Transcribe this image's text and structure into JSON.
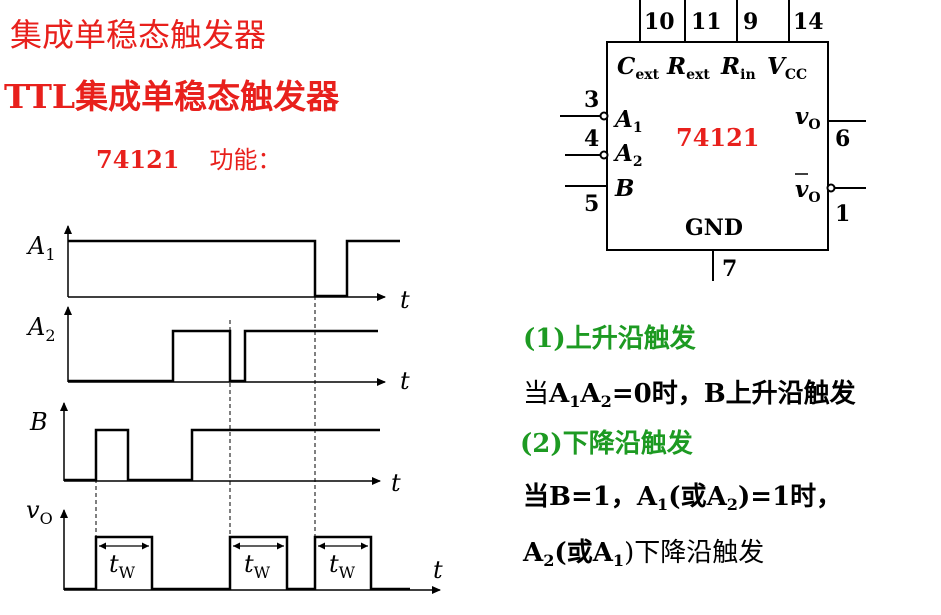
{
  "header": {
    "title": "集成单稳态触发器",
    "subtitle": "TTL集成单稳态触发器",
    "function_label": "74121",
    "function_text": "功能："
  },
  "chip": {
    "name": "74121",
    "gnd": "GND",
    "top_pins": [
      "10",
      "11",
      "9",
      "14"
    ],
    "top_labels": {
      "cext": "C",
      "cext_sub": "ext",
      "rext": "R",
      "rext_sub": "ext",
      "rin": "R",
      "rin_sub": "in",
      "vcc": "V",
      "vcc_sub": "CC"
    },
    "inputs": [
      {
        "pin": "3",
        "name": "A",
        "sub": "1"
      },
      {
        "pin": "4",
        "name": "A",
        "sub": "2"
      },
      {
        "pin": "5",
        "name": "B",
        "sub": ""
      }
    ],
    "outputs": [
      {
        "pin": "6",
        "name": "v",
        "sub": "O"
      },
      {
        "pin": "1",
        "name": "v",
        "sub": "O"
      }
    ],
    "bottom_pin": "7"
  },
  "timing": {
    "signals": [
      {
        "name": "A",
        "sub": "1"
      },
      {
        "name": "A",
        "sub": "2"
      },
      {
        "name": "B",
        "sub": ""
      },
      {
        "name": "v",
        "sub": "O"
      }
    ],
    "axis_label": "t",
    "pulse_label": "t",
    "pulse_label_sub": "W"
  },
  "description": {
    "rise_heading": "(1)上升沿触发",
    "rise_text_pre": "当",
    "rise_a1": "A",
    "rise_a1_sub": "1",
    "rise_a2": "A",
    "rise_a2_sub": "2",
    "rise_text_post": "=0时，B上升沿触发",
    "fall_heading": "(2)下降沿触发",
    "fall_line1_pre": "当B=1，",
    "fall_line1_a1": "A",
    "fall_line1_a1_sub": "1",
    "fall_line1_mid": "(或",
    "fall_line1_a2": "A",
    "fall_line1_a2_sub": "2",
    "fall_line1_post": ")=1时，",
    "fall_line2_a2": "A",
    "fall_line2_a2_sub": "2",
    "fall_line2_mid": "(或",
    "fall_line2_a1": "A",
    "fall_line2_a1_sub": "1",
    "fall_line2_post": ")下降沿触发"
  },
  "colors": {
    "title": "#e8201c",
    "heading": "#1d9a22",
    "text": "#000000"
  }
}
